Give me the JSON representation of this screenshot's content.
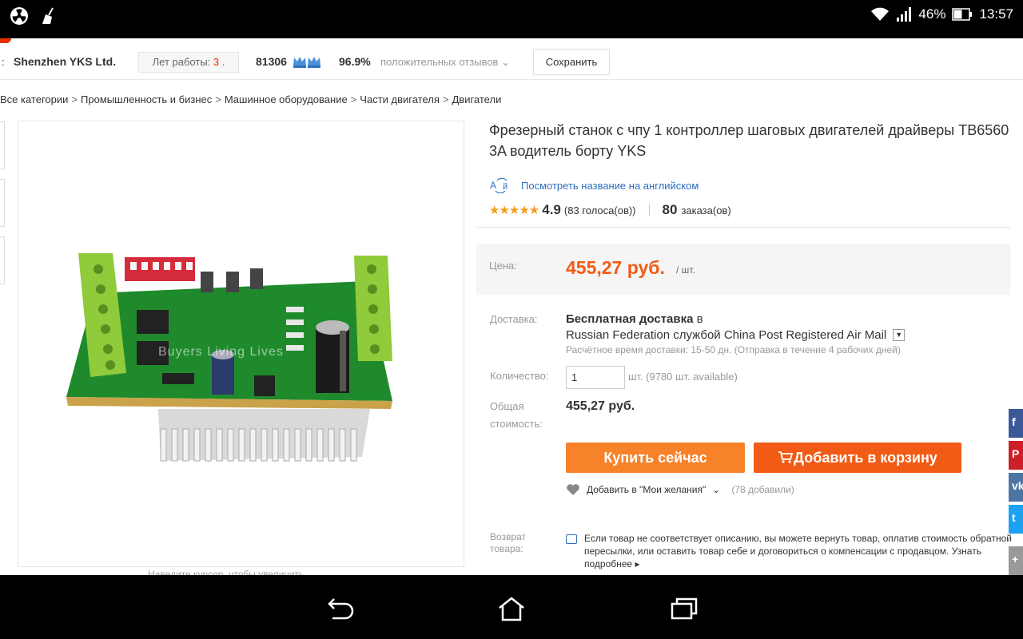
{
  "status": {
    "battery": "46%",
    "time": "13:57",
    "icons": [
      "radiation-icon",
      "broom-icon",
      "wifi-icon",
      "signal-icon",
      "battery-icon"
    ]
  },
  "store": {
    "colon": ":",
    "name": "Shenzhen YKS Ltd.",
    "years_label": "Лет работы:",
    "years_value": "3 .",
    "score": "81306",
    "positive_pct": "96.9%",
    "positive_label": "положительных отзывов",
    "save_label": "Сохранить"
  },
  "breadcrumbs": [
    "Все категории",
    "Промышленность и бизнес",
    "Машинное оборудование",
    "Части двигателя",
    "Двигатели"
  ],
  "breadcrumb_sep": ">",
  "product": {
    "title": "Фрезерный станок с чпу 1 контроллер шаговых двигателей драйверы TB6560 3A водитель борту YKS",
    "translate_label": "Посмотреть название на английском",
    "rating": "4.9",
    "votes": "(83 голоса(ов))",
    "orders": "80",
    "orders_label": "заказа(ов)",
    "watermark": "Buyers Living Lives"
  },
  "price": {
    "label": "Цена:",
    "value": "455,27 руб.",
    "unit": "/ шт."
  },
  "shipping": {
    "label": "Доставка:",
    "free": "Бесплатная доставка",
    "to": "в",
    "line2": "Russian Federation службой China Post Registered Air Mail",
    "dropdown": "▼",
    "estimate": "Расчётное время доставки: 15-50 дн. (Отправка в течение 4 рабочих дней)"
  },
  "quantity": {
    "label": "Количество:",
    "value": "1",
    "available": "шт. (9780 шт. available)"
  },
  "total": {
    "label_line1": "Общая",
    "label_line2": "стоимость:",
    "value": "455,27 руб."
  },
  "buttons": {
    "buy": "Купить сейчас",
    "cart": "Добавить в корзину"
  },
  "wishlist": {
    "label": "Добавить в \"Мои желания\"",
    "count": "(78 добавили)"
  },
  "returns": {
    "label_line1": "Возврат",
    "label_line2": "товара:",
    "text": "Если товар не соответствует описанию, вы можете вернуть товар, оплатив стоимость обратной пересылки, или оставить товар себе и договориться о компенсации с продавцом.",
    "more": "Узнать подробнее ▸"
  },
  "zoom_hint": "Наведите курсор, чтобы увеличить",
  "share_colors": [
    "#3b5998",
    "#cb2027",
    "#4c75a3",
    "#1da1f2",
    "#999999"
  ],
  "share_letters": [
    "f",
    "P",
    "vk",
    "t",
    "+"
  ],
  "accent": "#f15b15"
}
